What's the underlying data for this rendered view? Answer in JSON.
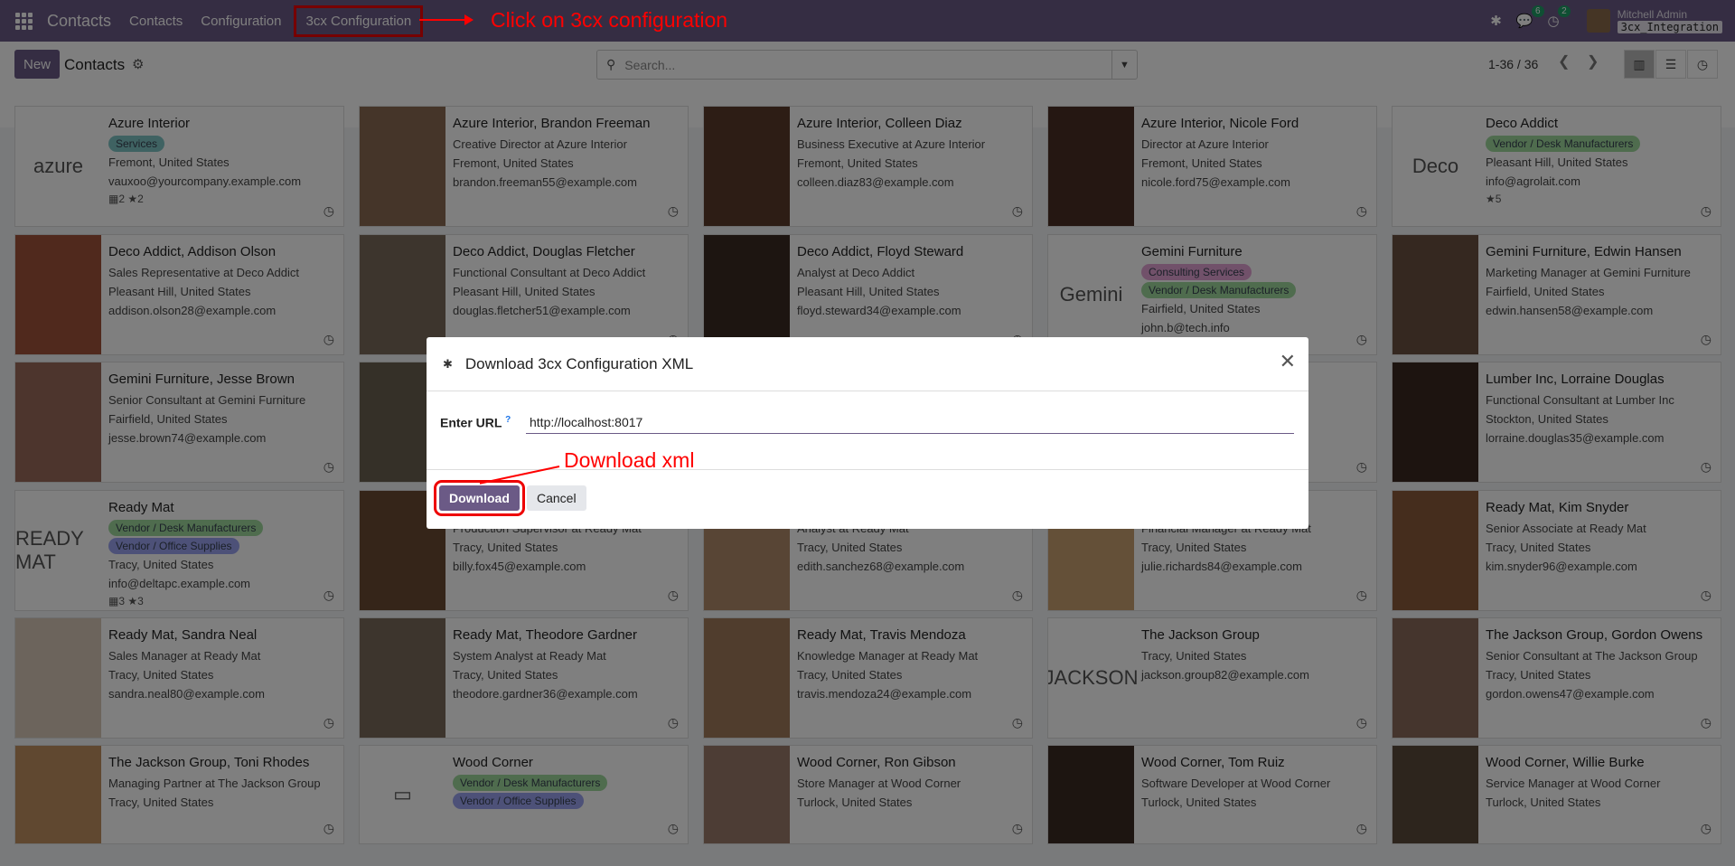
{
  "navbar": {
    "brand": "Contacts",
    "menu": [
      "Contacts",
      "Configuration",
      "3cx Configuration"
    ],
    "annotation": "Click on 3cx configuration",
    "badges": {
      "messages": "6",
      "activity": "2"
    },
    "user": "Mitchell Admin",
    "db": "3cx_Integration"
  },
  "control": {
    "new_label": "New",
    "title": "Contacts",
    "search_placeholder": "Search...",
    "pager": "1-36 / 36"
  },
  "cards": [
    {
      "name": "Azure Interior",
      "tags": [
        {
          "label": "Services",
          "kind": "services"
        }
      ],
      "lines": [
        "Fremont, United States",
        "vauxoo@yourcompany.example.com"
      ],
      "stats": "▦2  ★2",
      "logo": "azure"
    },
    {
      "name": "Azure Interior, Brandon Freeman",
      "lines": [
        "Creative Director at Azure Interior",
        "Fremont, United States",
        "brandon.freeman55@example.com"
      ],
      "color": "#8a6a52"
    },
    {
      "name": "Azure Interior, Colleen Diaz",
      "lines": [
        "Business Executive at Azure Interior",
        "Fremont, United States",
        "colleen.diaz83@example.com"
      ],
      "color": "#5b3a2a"
    },
    {
      "name": "Azure Interior, Nicole Ford",
      "lines": [
        "Director at Azure Interior",
        "Fremont, United States",
        "nicole.ford75@example.com"
      ],
      "color": "#4a2e24"
    },
    {
      "name": "Deco Addict",
      "tags": [
        {
          "label": "Vendor / Desk Manufacturers",
          "kind": "vendor"
        }
      ],
      "lines": [
        "Pleasant Hill, United States",
        "info@agrolait.com"
      ],
      "stats": "★5",
      "logo": "deco"
    },
    {
      "name": "Deco Addict, Addison Olson",
      "lines": [
        "Sales Representative at Deco Addict",
        "Pleasant Hill, United States",
        "addison.olson28@example.com"
      ],
      "color": "#a0523a"
    },
    {
      "name": "Deco Addict, Douglas Fletcher",
      "lines": [
        "Functional Consultant at Deco Addict",
        "Pleasant Hill, United States",
        "douglas.fletcher51@example.com"
      ],
      "color": "#7a6a5a"
    },
    {
      "name": "Deco Addict, Floyd Steward",
      "lines": [
        "Analyst at Deco Addict",
        "Pleasant Hill, United States",
        "floyd.steward34@example.com"
      ],
      "color": "#3a2a22"
    },
    {
      "name": "Gemini Furniture",
      "tags": [
        {
          "label": "Consulting Services",
          "kind": "consult"
        },
        {
          "label": "Vendor / Desk Manufacturers",
          "kind": "vendor"
        }
      ],
      "lines": [
        "Fairfield, United States",
        "john.b@tech.info"
      ],
      "logo": "gemini"
    },
    {
      "name": "Gemini Furniture, Edwin Hansen",
      "lines": [
        "Marketing Manager at Gemini Furniture",
        "Fairfield, United States",
        "edwin.hansen58@example.com"
      ],
      "color": "#6a5040"
    },
    {
      "name": "Gemini Furniture, Jesse Brown",
      "lines": [
        "Senior Consultant at Gemini Furniture",
        "Fairfield, United States",
        "jesse.brown74@example.com"
      ],
      "color": "#9a6a5a"
    },
    {
      "name": "",
      "lines": [],
      "color": "#6a6050"
    },
    {
      "name": "",
      "lines": [],
      "color": "#aaa"
    },
    {
      "name": "",
      "lines": [],
      "color": "#aaa"
    },
    {
      "name": "Lumber Inc, Lorraine Douglas",
      "lines": [
        "Functional Consultant at Lumber Inc",
        "Stockton, United States",
        "lorraine.douglas35@example.com"
      ],
      "color": "#3a2820"
    },
    {
      "name": "Ready Mat",
      "tags": [
        {
          "label": "Vendor / Desk Manufacturers",
          "kind": "vendor"
        },
        {
          "label": "Vendor / Office Supplies",
          "kind": "office"
        }
      ],
      "lines": [
        "Tracy, United States",
        "info@deltapc.example.com"
      ],
      "stats": "▦3  ★3",
      "logo": "ready"
    },
    {
      "name": "Ready Mat, Billy Fox",
      "lines": [
        "Production Supervisor at Ready Mat",
        "Tracy, United States",
        "billy.fox45@example.com"
      ],
      "color": "#6a4a32"
    },
    {
      "name": "Ready Mat, Edith Sanchez",
      "lines": [
        "Analyst at Ready Mat",
        "Tracy, United States",
        "edith.sanchez68@example.com"
      ],
      "color": "#b08a6a"
    },
    {
      "name": "Ready Mat, Julie Richards",
      "lines": [
        "Financial Manager at Ready Mat",
        "Tracy, United States",
        "julie.richards84@example.com"
      ],
      "color": "#c8a070"
    },
    {
      "name": "Ready Mat, Kim Snyder",
      "lines": [
        "Senior Associate at Ready Mat",
        "Tracy, United States",
        "kim.snyder96@example.com"
      ],
      "color": "#8a5a3a"
    },
    {
      "name": "Ready Mat, Sandra Neal",
      "lines": [
        "Sales Manager at Ready Mat",
        "Tracy, United States",
        "sandra.neal80@example.com"
      ],
      "color": "#d8c8b8"
    },
    {
      "name": "Ready Mat, Theodore Gardner",
      "lines": [
        "System Analyst at Ready Mat",
        "Tracy, United States",
        "theodore.gardner36@example.com"
      ],
      "color": "#7a6a5a"
    },
    {
      "name": "Ready Mat, Travis Mendoza",
      "lines": [
        "Knowledge Manager at Ready Mat",
        "Tracy, United States",
        "travis.mendoza24@example.com"
      ],
      "color": "#a07a5a"
    },
    {
      "name": "The Jackson Group",
      "lines": [
        "Tracy, United States",
        "jackson.group82@example.com"
      ],
      "logo": "jackson"
    },
    {
      "name": "The Jackson Group, Gordon Owens",
      "lines": [
        "Senior Consultant at The Jackson Group",
        "Tracy, United States",
        "gordon.owens47@example.com"
      ],
      "color": "#8a6a5a"
    },
    {
      "name": "The Jackson Group, Toni Rhodes",
      "lines": [
        "Managing Partner at The Jackson Group",
        "Tracy, United States"
      ],
      "color": "#c09060"
    },
    {
      "name": "Wood Corner",
      "tags": [
        {
          "label": "Vendor / Desk Manufacturers",
          "kind": "vendor"
        },
        {
          "label": "Vendor / Office Supplies",
          "kind": "office"
        }
      ],
      "lines": [],
      "logo": "wood"
    },
    {
      "name": "Wood Corner, Ron Gibson",
      "lines": [
        "Store Manager at Wood Corner",
        "Turlock, United States"
      ],
      "color": "#9a7a6a"
    },
    {
      "name": "Wood Corner, Tom Ruiz",
      "lines": [
        "Software Developer at Wood Corner",
        "Turlock, United States"
      ],
      "color": "#3a2a22"
    },
    {
      "name": "Wood Corner, Willie Burke",
      "lines": [
        "Service Manager at Wood Corner",
        "Turlock, United States"
      ],
      "color": "#5a4a3a"
    }
  ],
  "dialog": {
    "title": "Download 3cx Configuration XML",
    "label": "Enter URL",
    "help": "?",
    "value": "http://localhost:8017",
    "download": "Download",
    "cancel": "Cancel",
    "annotation": "Download xml"
  },
  "colors": {
    "brand": "#6b5a86",
    "annotation": "#ff0000"
  }
}
